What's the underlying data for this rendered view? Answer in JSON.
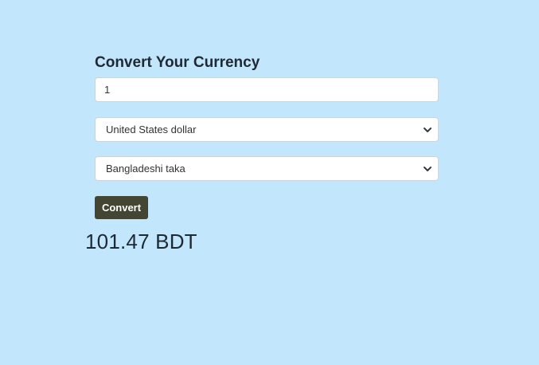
{
  "converter": {
    "title": "Convert Your Currency",
    "amount_value": "1",
    "from_currency": "United States dollar",
    "to_currency": "Bangladeshi taka",
    "convert_label": "Convert",
    "result": "101.47 BDT"
  },
  "icons": {
    "dropdown": "chevron-down-icon"
  },
  "colors": {
    "background": "#c2e6fb",
    "button": "#434632",
    "button_text": "#ffffff"
  }
}
